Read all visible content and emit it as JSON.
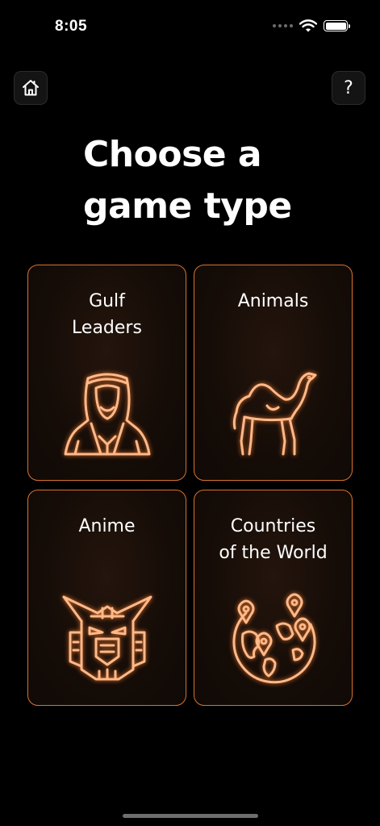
{
  "status_bar": {
    "time": "8:05"
  },
  "header": {
    "home_icon": "house-icon",
    "help_label": "?"
  },
  "title": "Choose a game type",
  "game_types": [
    {
      "label": "Gulf\nLeaders",
      "icon": "gulf-leader-icon"
    },
    {
      "label": "Animals",
      "icon": "camel-icon"
    },
    {
      "label": "Anime",
      "icon": "robot-mecha-icon"
    },
    {
      "label": "Countries\nof the World",
      "icon": "globe-pins-icon"
    }
  ],
  "colors": {
    "accent": "#d8722e",
    "icon_stroke": "#ffb98a",
    "glow": "#e8762c",
    "background": "#000000",
    "card_background": "#150c07"
  }
}
